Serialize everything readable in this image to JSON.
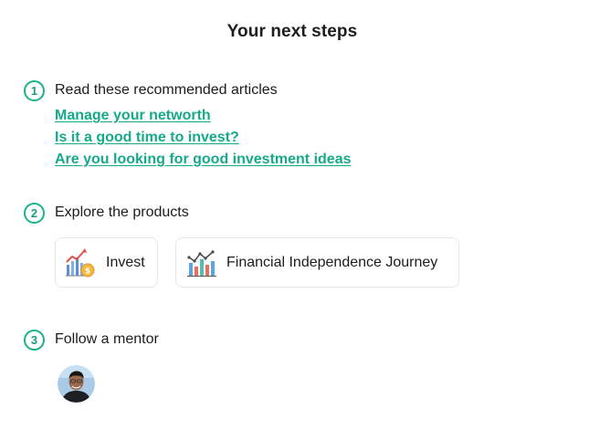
{
  "page": {
    "title": "Your next steps"
  },
  "steps": [
    {
      "number": "1",
      "label": "Read these recommended articles",
      "links": [
        "Manage your networth",
        "Is it a good time to invest?",
        "Are you looking for good investment ideas"
      ]
    },
    {
      "number": "2",
      "label": "Explore the products",
      "products": [
        {
          "label": "Invest",
          "icon": "invest-chart-coin-icon"
        },
        {
          "label": "Financial Independence Journey",
          "icon": "bar-chart-icon"
        }
      ]
    },
    {
      "number": "3",
      "label": "Follow a mentor",
      "mentors": [
        {
          "avatar": "mentor-avatar"
        }
      ]
    }
  ],
  "colors": {
    "accent": "#16a98a",
    "step_circle": "#1bb28a",
    "text": "#1c1c1c",
    "card_border": "#e6e6e6"
  }
}
